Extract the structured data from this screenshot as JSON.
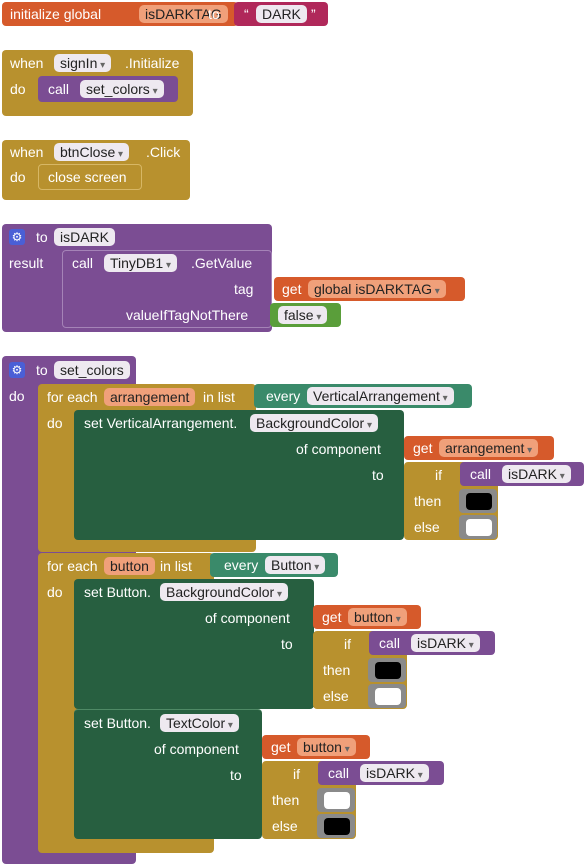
{
  "init_global": {
    "initialize_label": "initialize global",
    "var_name": "isDARKTAG",
    "to_label": "to",
    "quote_open": "“",
    "value": "DARK",
    "quote_close": "”"
  },
  "signin_event": {
    "when_label": "when",
    "component": "signIn",
    "event": ".Initialize",
    "do_label": "do",
    "call_label": "call",
    "procedure": "set_colors"
  },
  "btnclose_event": {
    "when_label": "when",
    "component": "btnClose",
    "event": ".Click",
    "do_label": "do",
    "action": "close screen"
  },
  "isdark_proc": {
    "to_label": "to",
    "name": "isDARK",
    "result_label": "result",
    "call_label": "call",
    "component": "TinyDB1",
    "method": ".GetValue",
    "tag_label": "tag",
    "get_label": "get",
    "tag_var": "global isDARKTAG",
    "valueiftag_label": "valueIfTagNotThere",
    "false_value": "false"
  },
  "setcolors_proc": {
    "to_label": "to",
    "name": "set_colors",
    "do_label": "do",
    "loop1": {
      "for_each": "for each",
      "var": "arrangement",
      "in_list": "in list",
      "every_label": "every",
      "every_type": "VerticalArrangement",
      "do_label": "do",
      "set_label": "set VerticalArrangement.",
      "property": "BackgroundColor",
      "of_component": "of component",
      "get_label": "get",
      "get_var": "arrangement",
      "to_label": "to",
      "if_label": "if",
      "call_label": "call",
      "call_proc": "isDARK",
      "then_label": "then",
      "else_label": "else"
    },
    "loop2": {
      "for_each": "for each",
      "var": "button",
      "in_list": "in list",
      "every_label": "every",
      "every_type": "Button",
      "do_label": "do",
      "set1_label": "set Button.",
      "set1_property": "BackgroundColor",
      "of_component1": "of component",
      "get1_label": "get",
      "get1_var": "button",
      "to1_label": "to",
      "if1_label": "if",
      "call1_label": "call",
      "call1_proc": "isDARK",
      "then1_label": "then",
      "else1_label": "else",
      "set2_label": "set Button.",
      "set2_property": "TextColor",
      "of_component2": "of component",
      "get2_label": "get",
      "get2_var": "button",
      "to2_label": "to",
      "if2_label": "if",
      "call2_label": "call",
      "call2_proc": "isDARK",
      "then2_label": "then",
      "else2_label": "else"
    }
  },
  "colors": {
    "orange": "#d65a2b",
    "gold": "#b8912e",
    "purple": "#7b4d93",
    "dark_green": "#275f40",
    "light_green": "#5a9e3a",
    "pink": "#b0285a",
    "teal": "#3a8a6a"
  }
}
